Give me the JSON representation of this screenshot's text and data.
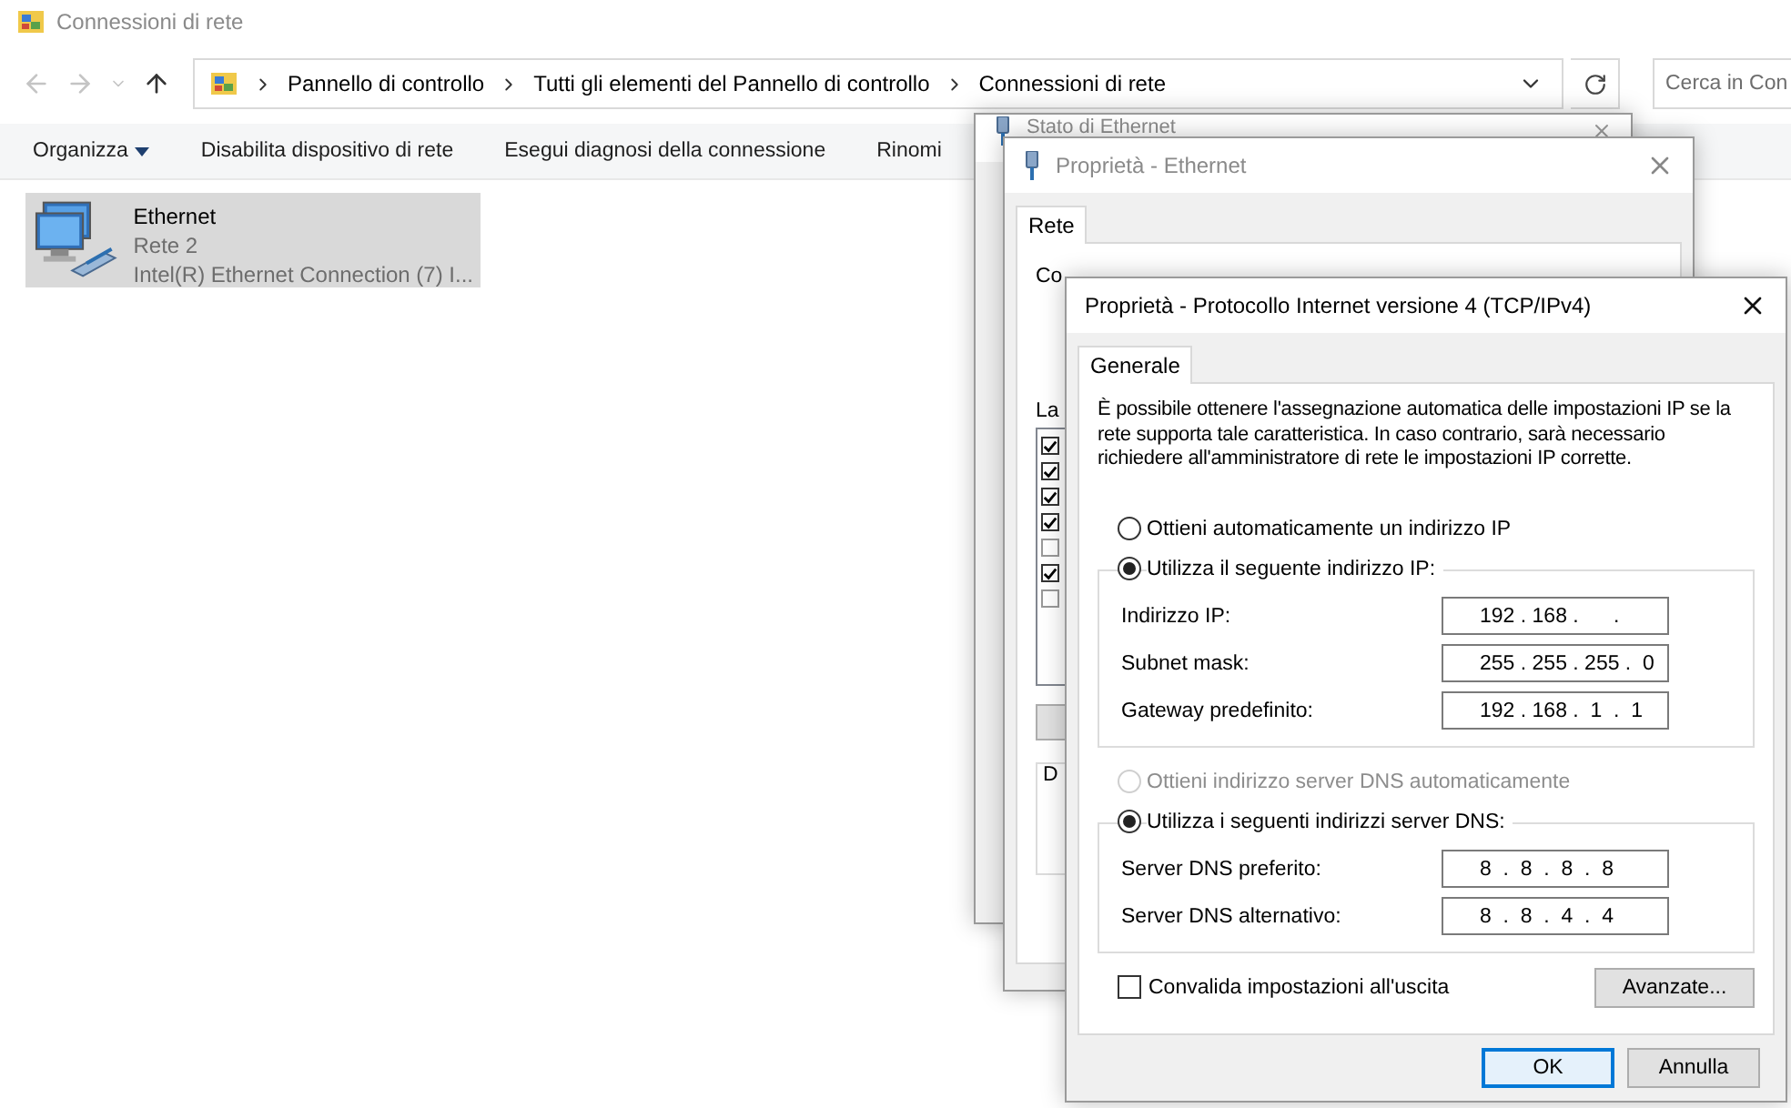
{
  "explorer": {
    "title": "Connessioni di rete",
    "breadcrumb": [
      "Pannello di controllo",
      "Tutti gli elementi del Pannello di controllo",
      "Connessioni di rete"
    ],
    "search": {
      "placeholder": "Cerca in Con"
    },
    "commands": [
      {
        "label": "Organizza",
        "dropdown": true
      },
      {
        "label": "Disabilita dispositivo di rete",
        "dropdown": false
      },
      {
        "label": "Esegui diagnosi della connessione",
        "dropdown": false
      },
      {
        "label": "Rinomi",
        "dropdown": false
      }
    ],
    "items": [
      {
        "name": "Ethernet",
        "network": "Rete 2",
        "device": "Intel(R) Ethernet Connection (7) I...",
        "selected": true
      }
    ]
  },
  "status_window": {
    "title": "Stato di Ethernet"
  },
  "ethernet_window": {
    "title": "Proprietà - Ethernet",
    "tabs": [
      {
        "label": "Rete",
        "selected": true
      }
    ],
    "connect_label": "Co",
    "list_label": "La",
    "components": [
      {
        "checked": true
      },
      {
        "checked": true
      },
      {
        "checked": true
      },
      {
        "checked": true
      },
      {
        "checked": false
      },
      {
        "checked": true
      },
      {
        "checked": false
      }
    ],
    "group_label": "D"
  },
  "ipv4_window": {
    "title": "Proprietà - Protocollo Internet versione 4 (TCP/IPv4)",
    "tabs": [
      {
        "label": "Generale",
        "selected": true
      }
    ],
    "description": "È possibile ottenere l'assegnazione automatica delle impostazioni IP se la rete supporta tale caratteristica. In caso contrario, sarà necessario richiedere all'amministratore di rete le impostazioni IP corrette.",
    "sections": [
      {
        "auto": {
          "label": "Ottieni automaticamente un indirizzo IP",
          "selected": false,
          "disabled": false
        },
        "manual": {
          "label": "Utilizza il seguente indirizzo IP:",
          "selected": true
        },
        "fields": [
          {
            "label": "Indirizzo IP:",
            "value": "192 . 168 .      ."
          },
          {
            "label": "Subnet mask:",
            "value": "255 . 255 . 255 .  0"
          },
          {
            "label": "Gateway predefinito:",
            "value": "192 . 168 .  1  .  1"
          }
        ]
      },
      {
        "auto": {
          "label": "Ottieni indirizzo server DNS automaticamente",
          "selected": false,
          "disabled": true
        },
        "manual": {
          "label": "Utilizza i seguenti indirizzi server DNS:",
          "selected": true
        },
        "fields": [
          {
            "label": "Server DNS preferito:",
            "value": "8  .  8  .  8  .  8"
          },
          {
            "label": "Server DNS alternativo:",
            "value": "8  .  8  .  4  .  4"
          }
        ]
      }
    ],
    "validate": {
      "label": "Convalida impostazioni all'uscita",
      "checked": false
    },
    "advanced_button": "Avanzate...",
    "buttons": [
      {
        "label": "OK",
        "default": true
      },
      {
        "label": "Annulla",
        "default": false
      }
    ]
  }
}
